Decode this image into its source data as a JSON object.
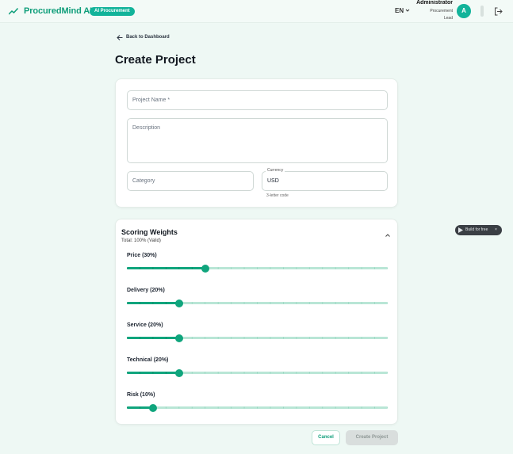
{
  "header": {
    "brand": "ProcuredMind AI",
    "badge": "AI Procurement",
    "language": "EN",
    "user_name": "Administrator",
    "user_role_line1": "Procurement",
    "user_role_line2": "Lead",
    "avatar_initial": "A"
  },
  "nav": {
    "back_label": "Back to Dashboard"
  },
  "page": {
    "title": "Create Project"
  },
  "form": {
    "project_name_placeholder": "Project Name *",
    "description_placeholder": "Description",
    "category_placeholder": "Category",
    "currency_label": "Currency",
    "currency_value": "USD",
    "currency_helper": "3-letter code"
  },
  "weights": {
    "title": "Scoring Weights",
    "total": "Total: 100% (Valid)",
    "sliders": [
      {
        "label": "Price (30%)",
        "value": 30
      },
      {
        "label": "Delivery (20%)",
        "value": 20
      },
      {
        "label": "Service (20%)",
        "value": 20
      },
      {
        "label": "Technical (20%)",
        "value": 20
      },
      {
        "label": "Risk (10%)",
        "value": 10
      }
    ]
  },
  "actions": {
    "cancel": "Cancel",
    "create": "Create Project"
  },
  "widget": {
    "label": "Build for free",
    "close": "×"
  },
  "colors": {
    "accent": "#10a57d",
    "badge": "#12b39a",
    "track": "#b9e6d6"
  }
}
